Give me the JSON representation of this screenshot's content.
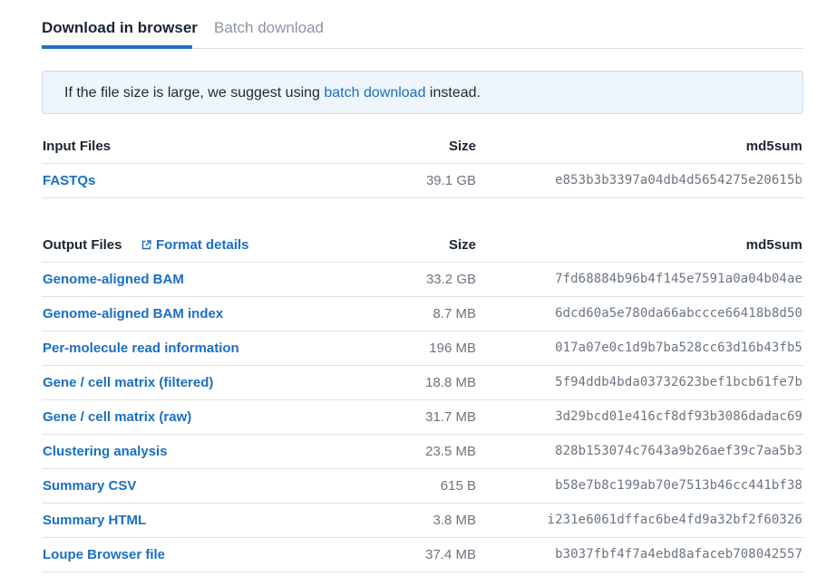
{
  "tabs": {
    "active": "Download in browser",
    "inactive": "Batch download"
  },
  "notice": {
    "before": "If the file size is large, we suggest using ",
    "link": "batch download",
    "after": " instead."
  },
  "input_table": {
    "headers": {
      "name": "Input Files",
      "size": "Size",
      "md5": "md5sum"
    },
    "rows": [
      {
        "name": "FASTQs",
        "size": "39.1 GB",
        "md5": "e853b3b3397a04db4d5654275e20615b"
      }
    ]
  },
  "output_table": {
    "headers": {
      "name": "Output Files",
      "format_link": "Format details",
      "size": "Size",
      "md5": "md5sum"
    },
    "rows": [
      {
        "name": "Genome-aligned BAM",
        "size": "33.2 GB",
        "md5": "7fd68884b96b4f145e7591a0a04b04ae"
      },
      {
        "name": "Genome-aligned BAM index",
        "size": "8.7 MB",
        "md5": "6dcd60a5e780da66abccce66418b8d50"
      },
      {
        "name": "Per-molecule read information",
        "size": "196 MB",
        "md5": "017a07e0c1d9b7ba528cc63d16b43fb5"
      },
      {
        "name": "Gene / cell matrix (filtered)",
        "size": "18.8 MB",
        "md5": "5f94ddb4bda03732623bef1bcb61fe7b"
      },
      {
        "name": "Gene / cell matrix (raw)",
        "size": "31.7 MB",
        "md5": "3d29bcd01e416cf8df93b3086dadac69"
      },
      {
        "name": "Clustering analysis",
        "size": "23.5 MB",
        "md5": "828b153074c7643a9b26aef39c7aa5b3"
      },
      {
        "name": "Summary CSV",
        "size": "615 B",
        "md5": "b58e7b8c199ab70e7513b46cc441bf38"
      },
      {
        "name": "Summary HTML",
        "size": "3.8 MB",
        "md5": "i231e6061dffac6be4fd9a32bf2f60326"
      },
      {
        "name": "Loupe Browser file",
        "size": "37.4 MB",
        "md5": "b3037fbf4f7a4ebd8afaceb708042557"
      }
    ]
  },
  "colors": {
    "accent": "#1a73c9",
    "link": "#1a6fc4"
  },
  "icons": {
    "format_details": "external-link-icon"
  }
}
